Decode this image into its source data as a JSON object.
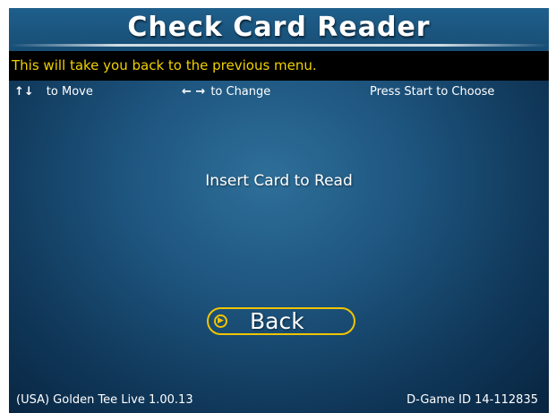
{
  "title": "Check Card Reader",
  "help_text": "This will take you back to the previous menu.",
  "controls": {
    "move_icon": "up-down-arrows-icon",
    "move_glyph": "↑↓",
    "move_label": "to Move",
    "change_icon": "left-right-arrows-icon",
    "change_glyph": "← →",
    "change_label": "to Change",
    "choose_label": "Press Start to Choose"
  },
  "message": "Insert Card to Read",
  "back_button": {
    "label": "Back",
    "icon": "play-circle-icon",
    "icon_glyph": "▶"
  },
  "footer": {
    "left": "(USA) Golden Tee Live 1.00.13",
    "right": "D-Game ID 14-112835"
  },
  "colors": {
    "help_text": "#f0d000",
    "button_outline": "#f0c400",
    "background": "#1e5680"
  }
}
